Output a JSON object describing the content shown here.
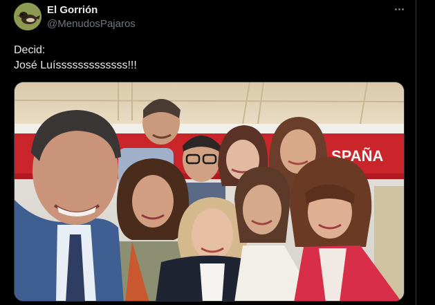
{
  "tweet": {
    "author": {
      "display_name": "El Gorrión",
      "handle": "@MenudosPajaros",
      "avatar_icon": "sparrow-avatar-icon"
    },
    "more_icon": "more-options-icon",
    "text_lines": [
      "Decid:",
      "José Luísssssssssssss!!!"
    ],
    "media": {
      "type": "photo",
      "sign_text": "SPAÑA"
    }
  }
}
